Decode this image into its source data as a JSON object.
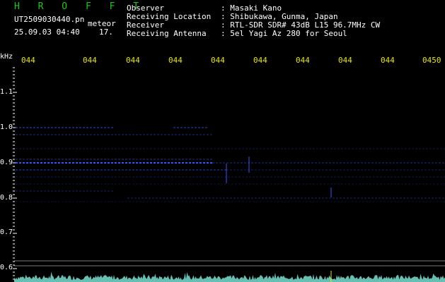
{
  "app": {
    "logo_text": "H R O F F T",
    "filename": "UT2509030440.pn",
    "mode": "meteor",
    "datetime": "25.09.03 04:40",
    "extra": "17."
  },
  "info": [
    {
      "label": "Observer",
      "value": ": Masaki Kano"
    },
    {
      "label": "Receiving Location",
      "value": ": Shibukawa, Gunma, Japan"
    },
    {
      "label": "Receiver",
      "value": ": RTL-SDR SDR# 43dB L15 96.7MHz CW"
    },
    {
      "label": "Receiving Antenna",
      "value": ": 5el Yagi Az 280 for Seoul"
    }
  ],
  "axes": {
    "freq_unit": "kHz",
    "freq_ticks": [
      "1.1",
      "1.0",
      "0.9",
      "0.8",
      "0.7",
      "0.6"
    ],
    "time_ticks": [
      "044",
      "044",
      "044",
      "044",
      "044",
      "044",
      "044",
      "044",
      "044",
      "0450"
    ]
  },
  "colors": {
    "background": "#000000",
    "signal": "#3355ff",
    "axis_text": "#ffffff",
    "time_text": "#e6e600",
    "logo": "#19c919",
    "baseline": "#88ffee"
  }
}
